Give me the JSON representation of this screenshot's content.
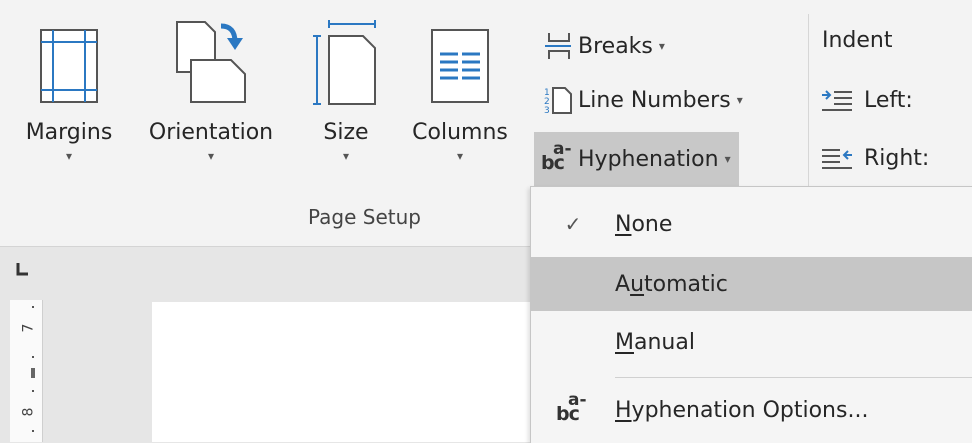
{
  "ribbon": {
    "margins": {
      "label": "Margins",
      "caret": "▾"
    },
    "orientation": {
      "label": "Orientation",
      "caret": "▾"
    },
    "size": {
      "label": "Size",
      "caret": "▾"
    },
    "columns": {
      "label": "Columns",
      "caret": "▾"
    },
    "breaks": {
      "label": "Breaks",
      "caret": "▾"
    },
    "line_numbers": {
      "label": "Line Numbers",
      "caret": "▾"
    },
    "hyphenation": {
      "label": "Hyphenation",
      "caret": "▾"
    },
    "group_label": "Page Setup",
    "indent": {
      "title": "Indent",
      "left": "Left:",
      "right": "Right:"
    }
  },
  "ruler": {
    "numbers": [
      "7",
      "8"
    ]
  },
  "menu": {
    "items": [
      {
        "label": "None",
        "access_key_index": 0,
        "checked": true
      },
      {
        "label": "Automatic",
        "access_key_index": 1,
        "checked": false
      },
      {
        "label": "Manual",
        "access_key_index": 0,
        "checked": false
      },
      {
        "label": "Hyphenation Options...",
        "access_key_index": 0,
        "checked": false
      }
    ],
    "check_glyph": "✓"
  },
  "colors": {
    "accent_blue": "#2b78c2",
    "menu_hover": "#c6c6c6",
    "ribbon_bg": "#f3f3f3"
  }
}
